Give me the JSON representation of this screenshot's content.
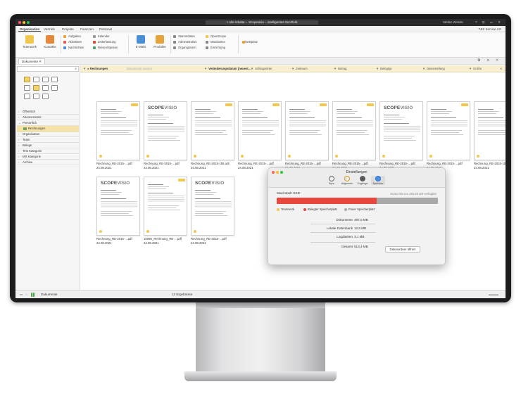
{
  "window": {
    "title": "Scopevisio – intelligentes Suchfeld",
    "search_label": "Alle Inhalte",
    "user": "Stefan Wissler",
    "controls": "? ⊡ ▭ ✕"
  },
  "menu": {
    "tabs": [
      "Organisation",
      "Vertrieb",
      "Projekte",
      "Finanzen",
      "Personal"
    ],
    "company": "T&S Service AG"
  },
  "ribbon": {
    "teamwork": "Teamwork",
    "kontakte": "Kontakte",
    "aufgaben": "Aufgaben",
    "aktivitaeten": "Aktivitäten",
    "nachrichten": "Nachrichten",
    "kalender": "Kalender",
    "zeiterfassung": "Zeiterfassung",
    "reisen": "Reisen/Spesen",
    "emails": "E-Mails",
    "produkte": "Produkte",
    "stammdaten": "Stammdaten",
    "administration": "Administration",
    "organigramm": "Organigramm",
    "openscope": "OpenScope",
    "mandanten": "Mandanten",
    "einrichtung": "Einrichtung",
    "arbeitsplatz": "Arbeitsplatz"
  },
  "doc_tab": "Dokumente",
  "filters": {
    "query": "Rechnungen",
    "doc_search_placeholder": "Dokumente suchen",
    "sort": "Veränderungsdatum (neuest…",
    "schlagwoerter": "Schlagwörter",
    "zeitraum": "Zeitraum",
    "betrag": "Betrag",
    "betrag2": "Betrag",
    "belegtyp": "Belegtyp",
    "datenstellung": "Datenstellung",
    "groesse": "Größe"
  },
  "sidebar": {
    "items": [
      {
        "label": "Öffentlich",
        "open": false
      },
      {
        "label": "Abonnements",
        "open": false
      },
      {
        "label": "Persönlich",
        "open": true
      },
      {
        "label": "Rechnungen",
        "child": true
      },
      {
        "label": "Organisation",
        "open": false
      },
      {
        "label": "Team",
        "open": false
      },
      {
        "label": "Belege",
        "open": false
      },
      {
        "label": "Test Kategorie",
        "open": false
      },
      {
        "label": "MS Kategorie",
        "open": false
      },
      {
        "label": "Archive",
        "open": false
      }
    ]
  },
  "documents": [
    {
      "name": "Rechnung_RE-2015-…pdf",
      "date": "24.08.2021",
      "logo": false
    },
    {
      "name": "Rechnung_RE-2015-…pdf",
      "date": "24.08.2021",
      "logo": true
    },
    {
      "name": "Rechnung_RE-2015-155.odt",
      "date": "24.08.2021",
      "logo": false
    },
    {
      "name": "Rechnung_RE-2015-…pdf",
      "date": "24.08.2021",
      "logo": false
    },
    {
      "name": "Rechnung_RE-2015-…pdf",
      "date": "24.08.2021",
      "logo": false
    },
    {
      "name": "Rechnung_RE-2015-…pdf",
      "date": "24.08.2021",
      "logo": false
    },
    {
      "name": "Rechnung_RE-2015-…pdf",
      "date": "24.08.2021",
      "logo": true
    },
    {
      "name": "Rechnung_RE-2015-…pdf",
      "date": "24.08.2021",
      "logo": false
    },
    {
      "name": "Rechnung_RE-2015-107.odt",
      "date": "24.08.2021",
      "logo": false
    },
    {
      "name": "Rechnung_RE-2015-…pdf",
      "date": "24.08.2021",
      "logo": true
    },
    {
      "name": "10095_Rechnung_RE-…pdf",
      "date": "24.08.2021",
      "logo": false
    },
    {
      "name": "Rechnung_RE-2015-…pdf",
      "date": "24.08.2021",
      "logo": true
    }
  ],
  "logo_text": {
    "a": "SCOPE",
    "b": "VISIO"
  },
  "status": {
    "section": "Dokumente",
    "count": "12 Ergebnisse"
  },
  "settings": {
    "title": "Einstellungen",
    "tabs": [
      "Sync",
      "Allgemein",
      "Zugänge",
      "Speicher"
    ],
    "disk": "Macintosh SSD",
    "disk_info": "94,54 GB von 250,69 GB verfügbar",
    "used_fraction": 0.62,
    "legend": [
      "Teamwork",
      "Belegter Speicherplatz",
      "Freier Speicherplatz"
    ],
    "stats": [
      {
        "key": "Dokumente",
        "value": "497,5 MB"
      },
      {
        "key": "Lokale Datenbank",
        "value": "12,8 MB"
      },
      {
        "key": "Logdateien",
        "value": "3,1 MB"
      },
      {
        "key": "Gesamt",
        "value": "513,4 MB"
      }
    ],
    "button": "Datenordner öffnen"
  },
  "colors": {
    "accent": "#f1c84d",
    "red": "#e8473f",
    "gray": "#a9a9a9"
  }
}
